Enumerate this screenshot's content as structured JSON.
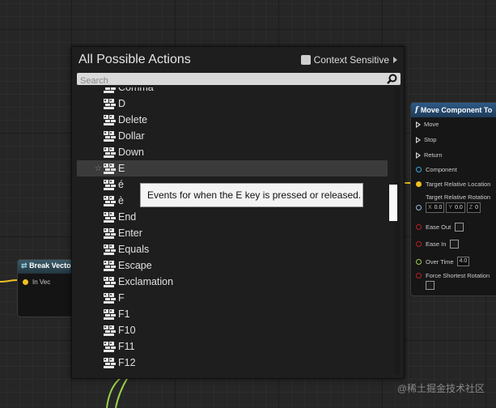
{
  "menu": {
    "title": "All Possible Actions",
    "context_sensitive_label": "Context Sensitive",
    "context_sensitive_checked": false,
    "search_placeholder": "Search",
    "items": [
      {
        "label": "Comma",
        "partial": true
      },
      {
        "label": "D"
      },
      {
        "label": "Delete"
      },
      {
        "label": "Dollar"
      },
      {
        "label": "Down"
      },
      {
        "label": "E",
        "selected": true
      },
      {
        "label": "é"
      },
      {
        "label": "è"
      },
      {
        "label": "End"
      },
      {
        "label": "Enter"
      },
      {
        "label": "Equals"
      },
      {
        "label": "Escape"
      },
      {
        "label": "Exclamation"
      },
      {
        "label": "F"
      },
      {
        "label": "F1"
      },
      {
        "label": "F10"
      },
      {
        "label": "F11"
      },
      {
        "label": "F12"
      }
    ],
    "icon": "keyboard-key-icon",
    "tooltip": "Events for when the E key is pressed or released."
  },
  "break_node": {
    "title": "Break Vecto",
    "pin_label": "In Vec",
    "accent": "#f0c020"
  },
  "move_node": {
    "title": "Move Component To",
    "exec_pins": [
      "Move",
      "Stop",
      "Return"
    ],
    "component_label": "Component",
    "target_location_label": "Target Relative Location",
    "target_rotation_label": "Target Relative Rotation",
    "rotation": [
      {
        "axis": "X",
        "value": "0.0"
      },
      {
        "axis": "Y",
        "value": "0.0"
      },
      {
        "axis": "Z",
        "value": "0"
      }
    ],
    "ease_out_label": "Ease Out",
    "ease_in_label": "Ease In",
    "over_time_label": "Over Time",
    "over_time_value": "4.0",
    "force_shortest_label": "Force Shortest Rotation"
  },
  "watermark": "@稀土掘金技术社区"
}
